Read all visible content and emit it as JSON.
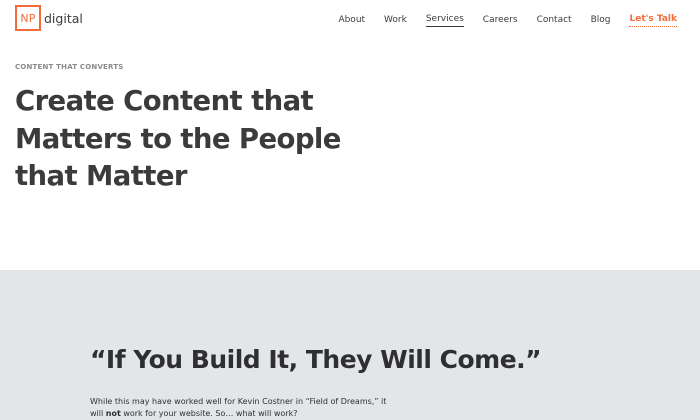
{
  "header": {
    "logo_mark": "NP",
    "logo_text": "digital",
    "nav": [
      {
        "label": "About"
      },
      {
        "label": "Work"
      },
      {
        "label": "Services"
      },
      {
        "label": "Careers"
      },
      {
        "label": "Contact"
      },
      {
        "label": "Blog"
      },
      {
        "label": "Let's Talk"
      }
    ]
  },
  "hero": {
    "eyebrow": "CONTENT THAT CONVERTS",
    "title_line1": "Create Content that",
    "title_line2": "Matters to the People",
    "title_line3": "that Matter"
  },
  "section": {
    "quote": "“If You Build It, They Will Come.”",
    "body_before": "While this may have worked well for Kevin Costner in “Field of Dreams,” it will ",
    "body_bold": "not",
    "body_after": " work for your website. So… what will work?"
  },
  "colors": {
    "accent": "#f26b3a",
    "text": "#3b3b3d",
    "band_bg": "#e3e6e9"
  }
}
